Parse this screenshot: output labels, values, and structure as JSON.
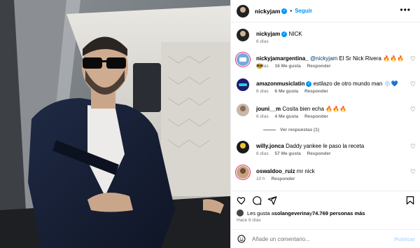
{
  "header": {
    "username": "nickyjam",
    "separator": "•",
    "follow_label": "Seguir",
    "more_icon": "more-horizontal-icon"
  },
  "caption": {
    "username": "nickyjam",
    "text": "NICK",
    "time": "6 días"
  },
  "comments": [
    {
      "username": "nickyjamargentina_",
      "mention": "@nickyjam",
      "text": " El Sr Nick Rivera 🔥🔥🔥😎",
      "time": "6 días",
      "likes": "16 Me gusta",
      "reply": "Responder"
    },
    {
      "username": "amazonmusiclatin",
      "verified": true,
      "text": " estilazo de otro mundo man ❄️💙",
      "time": "6 días",
      "likes": "6 Me gusta",
      "reply": "Responder"
    },
    {
      "username": "jouni__m",
      "text": " Cosita bien echa 🔥🔥🔥",
      "time": "6 días",
      "likes": "4 Me gusta",
      "reply": "Responder",
      "view_replies": "Ver respuestas (1)"
    },
    {
      "username": "willy.jonca",
      "text": " Daddy yankee le paso la receta",
      "time": "6 días",
      "likes": "57 Me gusta",
      "reply": "Responder"
    },
    {
      "username": "oswaldoo_ruiz",
      "text": " mr nick",
      "time": "10 h",
      "reply": "Responder"
    }
  ],
  "likes_summary": {
    "prefix": "Les gusta a ",
    "user": "solangeverina",
    "middle": " y ",
    "count": "74.769 personas más"
  },
  "post_time": "Hace 6 días",
  "add_comment": {
    "placeholder": "Añade un comentario...",
    "publish_label": "Publicar"
  },
  "colors": {
    "accent": "#0095f6",
    "muted": "#737373",
    "publish_disabled": "#b3dbff"
  }
}
